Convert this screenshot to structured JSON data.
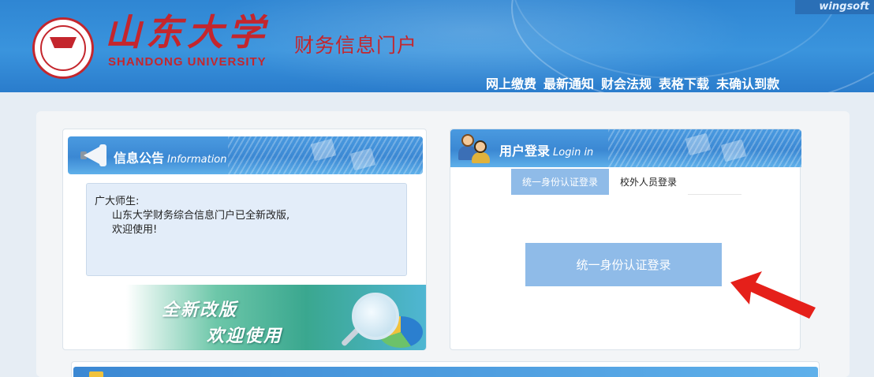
{
  "header": {
    "brand_corner": "wingsoft",
    "university_calligraphy": "山东大学",
    "university_en": "SHANDONG UNIVERSITY",
    "portal_title": "财务信息门户",
    "nav": [
      {
        "label": "网上缴费"
      },
      {
        "label": "最新通知"
      },
      {
        "label": "财会法规"
      },
      {
        "label": "表格下载"
      },
      {
        "label": "未确认到款"
      }
    ]
  },
  "info_panel": {
    "title": "信息公告",
    "title_en": "Information",
    "notice": {
      "greeting": "广大师生:",
      "line1": "山东大学财务综合信息门户已全新改版,",
      "line2": "欢迎使用!"
    },
    "banner": {
      "line1": "全新改版",
      "line2": "欢迎使用"
    }
  },
  "login_panel": {
    "title": "用户登录",
    "title_en": "Login in",
    "tabs": [
      {
        "label": "统一身份认证登录",
        "active": true
      },
      {
        "label": "校外人员登录",
        "active": false
      }
    ],
    "sso_button_label": "统一身份认证登录"
  },
  "colors": {
    "header_blue": "#2f86d3",
    "brand_red": "#c4262d",
    "button_blue": "#8fbbe8",
    "annotation_arrow": "#e5201a"
  },
  "icons": [
    "megaphone-icon",
    "users-icon",
    "magnifier-icon",
    "pie-chart-icon",
    "red-arrow-annotation"
  ]
}
